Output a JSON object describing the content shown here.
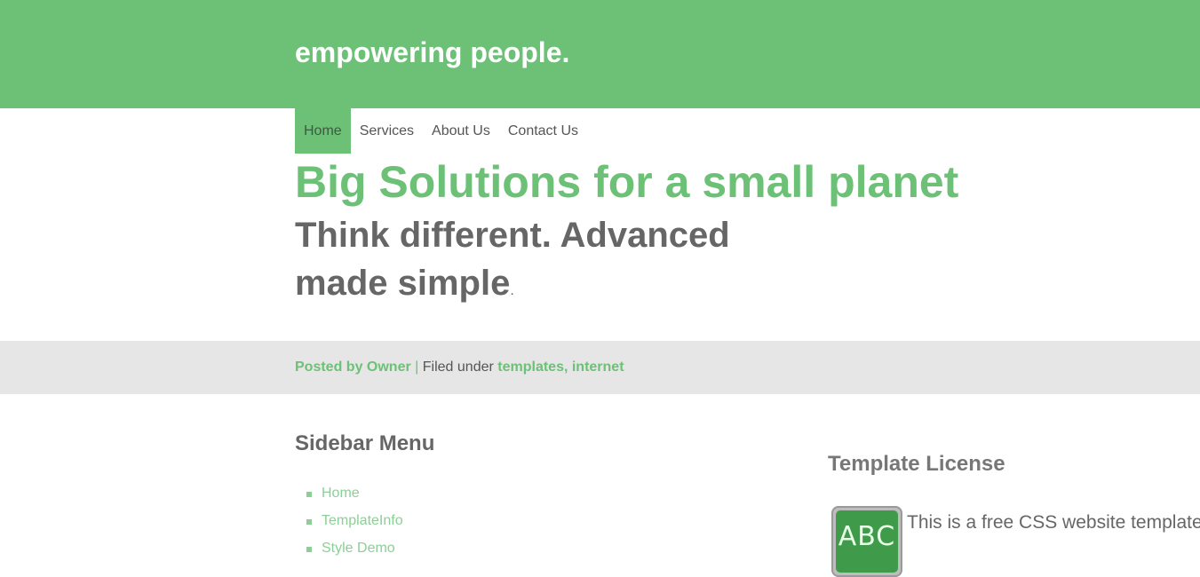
{
  "header": {
    "site_title": "empowering people.",
    "background_color": "#6cc177"
  },
  "nav": {
    "items": [
      {
        "label": "Home",
        "active": true
      },
      {
        "label": "Services",
        "active": false
      },
      {
        "label": "About Us",
        "active": false
      },
      {
        "label": "Contact Us",
        "active": false
      }
    ]
  },
  "hero": {
    "headline": "Big Solutions for a small planet",
    "subhead": "Think different. Advanced made simple",
    "subhead_period": "."
  },
  "meta": {
    "posted_by": "Posted by Owner",
    "separator": "|",
    "filed_under": "Filed under",
    "categories": "templates, internet"
  },
  "sidebar": {
    "title": "Sidebar Menu",
    "items": [
      "Home",
      "TemplateInfo",
      "Style Demo"
    ]
  },
  "license": {
    "title": "Template License",
    "icon_text": "ABC",
    "icon": "abc-board-icon",
    "text": "This is a free CSS website template b"
  },
  "colors": {
    "accent": "#6cc177",
    "meta_bar": "#e6e6e6",
    "text": "#666666"
  }
}
